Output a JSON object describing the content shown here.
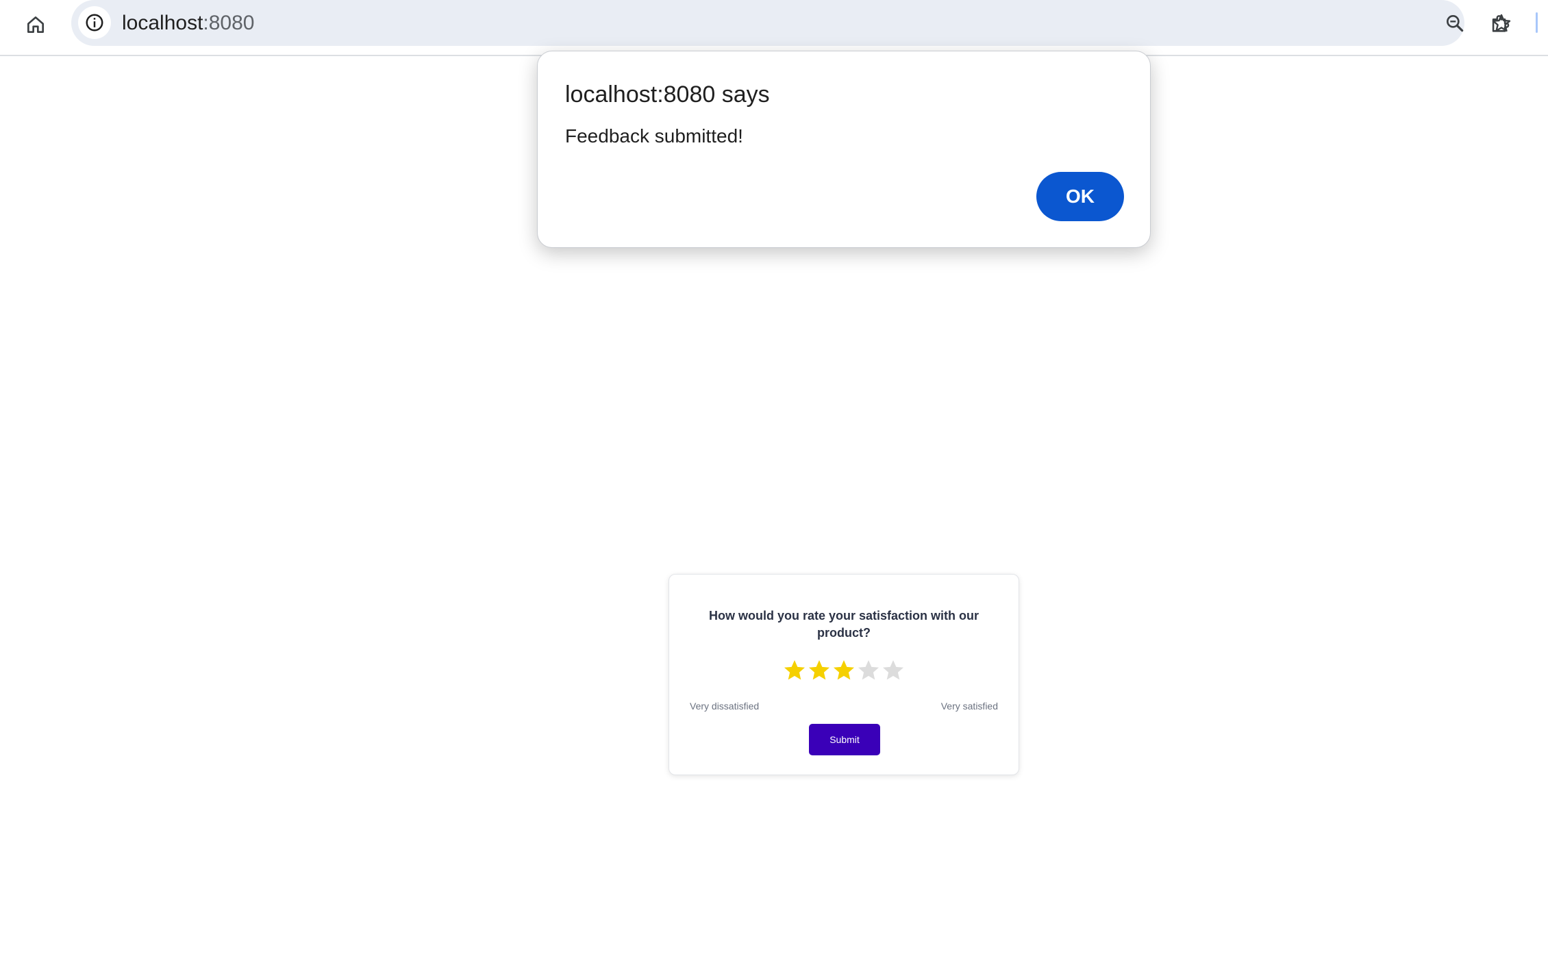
{
  "browser": {
    "url_host": "localhost",
    "url_port": ":8080",
    "icons": [
      "home-icon",
      "site-info-icon",
      "zoom-icon",
      "bookmark-star-icon",
      "extensions-icon"
    ]
  },
  "alert": {
    "title": "localhost:8080 says",
    "message": "Feedback submitted!",
    "ok_label": "OK"
  },
  "survey": {
    "question": "How would you rate your satisfaction with our product?",
    "rating": 3,
    "max_rating": 5,
    "low_label": "Very dissatisfied",
    "high_label": "Very satisfied",
    "submit_label": "Submit",
    "colors": {
      "star_filled": "#f5d000",
      "star_empty": "#dcdcdc",
      "submit_bg": "#3a00b8",
      "ok_bg": "#0b57d0"
    }
  }
}
